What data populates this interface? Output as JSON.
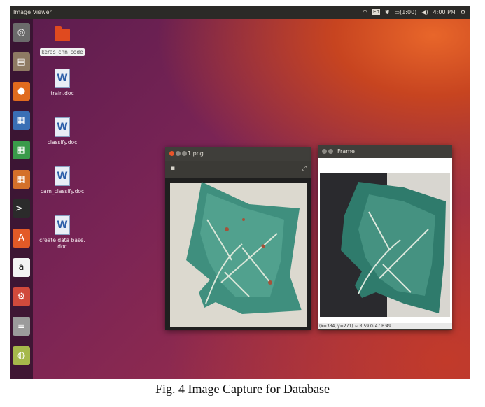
{
  "topbar": {
    "app_title": "Image Viewer",
    "indicators": [
      "En",
      "(1:00)",
      "4:00 PM"
    ]
  },
  "launcher": {
    "items": [
      {
        "name": "ubuntu-dash-icon",
        "glyph": "◎",
        "bg": "#6b6b6b"
      },
      {
        "name": "files-icon",
        "glyph": "▤",
        "bg": "#8e7a63"
      },
      {
        "name": "firefox-icon",
        "glyph": "●",
        "bg": "#e06b1e"
      },
      {
        "name": "writer-icon",
        "glyph": "▦",
        "bg": "#3a6fb5"
      },
      {
        "name": "calc-icon",
        "glyph": "▦",
        "bg": "#3a9a4a"
      },
      {
        "name": "impress-icon",
        "glyph": "▦",
        "bg": "#d4702a"
      },
      {
        "name": "terminal-icon",
        "glyph": ">_",
        "bg": "#2b2b2b"
      },
      {
        "name": "software-center-icon",
        "glyph": "A",
        "bg": "#e35a27"
      },
      {
        "name": "amazon-icon",
        "glyph": "a",
        "bg": "#f3f3f3"
      },
      {
        "name": "settings-icon",
        "glyph": "⚙",
        "bg": "#d14a3c"
      },
      {
        "name": "drive-icon",
        "glyph": "≡",
        "bg": "#9b9b9b"
      },
      {
        "name": "image-viewer-icon",
        "glyph": "◍",
        "bg": "#a6b84b"
      }
    ]
  },
  "desktop": {
    "icons": [
      {
        "label": "keras_cnn_code",
        "type": "folder",
        "selected": true
      },
      {
        "label": "train.doc",
        "type": "doc"
      },
      {
        "label": "classify.doc",
        "type": "doc"
      },
      {
        "label": "cam_classify.doc",
        "type": "doc"
      },
      {
        "label": "create data base.\ndoc",
        "type": "doc"
      }
    ]
  },
  "viewer": {
    "title": "1.png"
  },
  "frame": {
    "title": "Frame",
    "readout": "(x=334, y=271) ~ R:59 G:47 B:49"
  },
  "caption": "Fig. 4 Image Capture for Database"
}
